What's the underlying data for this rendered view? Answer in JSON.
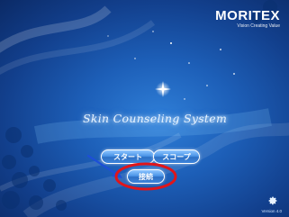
{
  "app": {
    "brand_name": "MORITEX",
    "brand_tagline": "Vision Creating Value",
    "title": "Skin Counseling System",
    "version": "Version 4.0"
  },
  "buttons": {
    "start_label": "スタート",
    "scope_label": "スコープ",
    "connect_label": "接続"
  },
  "annotation": {
    "highlight_color": "#e0151a",
    "arrow_color": "#1d4fd8"
  },
  "icons": {
    "settings": "gear-icon"
  }
}
